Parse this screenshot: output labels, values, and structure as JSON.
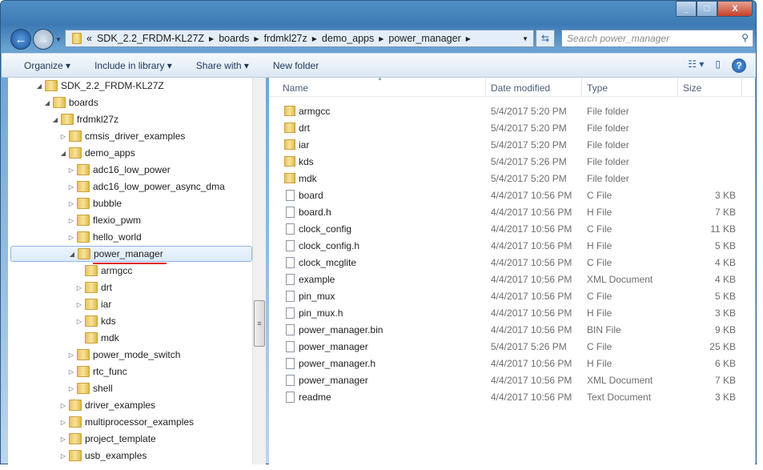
{
  "window": {
    "minimize": "_",
    "maximize": "□",
    "close": "X"
  },
  "address": {
    "prefix": "«",
    "segments": [
      "SDK_2.2_FRDM-KL27Z",
      "boards",
      "frdmkl27z",
      "demo_apps",
      "power_manager"
    ]
  },
  "search": {
    "placeholder": "Search power_manager"
  },
  "toolbar": {
    "organize": "Organize ▾",
    "include": "Include in library ▾",
    "share": "Share with ▾",
    "new_folder": "New folder",
    "views": "☷ ▾",
    "preview": "▯",
    "help": "?"
  },
  "tree": [
    {
      "label": "SDK_2.2_FRDM-KL27Z",
      "level": 0,
      "state": "expanded"
    },
    {
      "label": "boards",
      "level": 1,
      "state": "expanded"
    },
    {
      "label": "frdmkl27z",
      "level": 2,
      "state": "expanded"
    },
    {
      "label": "cmsis_driver_examples",
      "level": 3,
      "state": "collapsed"
    },
    {
      "label": "demo_apps",
      "level": 3,
      "state": "expanded"
    },
    {
      "label": "adc16_low_power",
      "level": 4,
      "state": "collapsed"
    },
    {
      "label": "adc16_low_power_async_dma",
      "level": 4,
      "state": "collapsed"
    },
    {
      "label": "bubble",
      "level": 4,
      "state": "collapsed"
    },
    {
      "label": "flexio_pwm",
      "level": 4,
      "state": "collapsed"
    },
    {
      "label": "hello_world",
      "level": 4,
      "state": "collapsed"
    },
    {
      "label": "power_manager",
      "level": 4,
      "state": "expanded",
      "selected": true
    },
    {
      "label": "armgcc",
      "level": 5,
      "state": "none"
    },
    {
      "label": "drt",
      "level": 5,
      "state": "collapsed"
    },
    {
      "label": "iar",
      "level": 5,
      "state": "collapsed"
    },
    {
      "label": "kds",
      "level": 5,
      "state": "collapsed"
    },
    {
      "label": "mdk",
      "level": 5,
      "state": "none"
    },
    {
      "label": "power_mode_switch",
      "level": 4,
      "state": "collapsed"
    },
    {
      "label": "rtc_func",
      "level": 4,
      "state": "collapsed"
    },
    {
      "label": "shell",
      "level": 4,
      "state": "collapsed"
    },
    {
      "label": "driver_examples",
      "level": 3,
      "state": "collapsed"
    },
    {
      "label": "multiprocessor_examples",
      "level": 3,
      "state": "collapsed"
    },
    {
      "label": "project_template",
      "level": 3,
      "state": "collapsed"
    },
    {
      "label": "usb_examples",
      "level": 3,
      "state": "collapsed"
    }
  ],
  "columns": {
    "name": "Name",
    "date": "Date modified",
    "type": "Type",
    "size": "Size"
  },
  "files": [
    {
      "name": "armgcc",
      "date": "5/4/2017 5:20 PM",
      "type": "File folder",
      "size": "",
      "kind": "folder"
    },
    {
      "name": "drt",
      "date": "5/4/2017 5:20 PM",
      "type": "File folder",
      "size": "",
      "kind": "folder"
    },
    {
      "name": "iar",
      "date": "5/4/2017 5:20 PM",
      "type": "File folder",
      "size": "",
      "kind": "folder"
    },
    {
      "name": "kds",
      "date": "5/4/2017 5:26 PM",
      "type": "File folder",
      "size": "",
      "kind": "folder"
    },
    {
      "name": "mdk",
      "date": "5/4/2017 5:20 PM",
      "type": "File folder",
      "size": "",
      "kind": "folder"
    },
    {
      "name": "board",
      "date": "4/4/2017 10:56 PM",
      "type": "C File",
      "size": "3 KB",
      "kind": "file"
    },
    {
      "name": "board.h",
      "date": "4/4/2017 10:56 PM",
      "type": "H File",
      "size": "7 KB",
      "kind": "file"
    },
    {
      "name": "clock_config",
      "date": "4/4/2017 10:56 PM",
      "type": "C File",
      "size": "11 KB",
      "kind": "file"
    },
    {
      "name": "clock_config.h",
      "date": "4/4/2017 10:56 PM",
      "type": "H File",
      "size": "5 KB",
      "kind": "file"
    },
    {
      "name": "clock_mcglite",
      "date": "4/4/2017 10:56 PM",
      "type": "C File",
      "size": "4 KB",
      "kind": "file"
    },
    {
      "name": "example",
      "date": "4/4/2017 10:56 PM",
      "type": "XML Document",
      "size": "4 KB",
      "kind": "file"
    },
    {
      "name": "pin_mux",
      "date": "4/4/2017 10:56 PM",
      "type": "C File",
      "size": "5 KB",
      "kind": "file"
    },
    {
      "name": "pin_mux.h",
      "date": "4/4/2017 10:56 PM",
      "type": "H File",
      "size": "3 KB",
      "kind": "file"
    },
    {
      "name": "power_manager.bin",
      "date": "4/4/2017 10:56 PM",
      "type": "BIN File",
      "size": "9 KB",
      "kind": "file"
    },
    {
      "name": "power_manager",
      "date": "5/4/2017 5:26 PM",
      "type": "C File",
      "size": "25 KB",
      "kind": "file"
    },
    {
      "name": "power_manager.h",
      "date": "4/4/2017 10:56 PM",
      "type": "H File",
      "size": "6 KB",
      "kind": "file"
    },
    {
      "name": "power_manager",
      "date": "4/4/2017 10:56 PM",
      "type": "XML Document",
      "size": "7 KB",
      "kind": "file"
    },
    {
      "name": "readme",
      "date": "4/4/2017 10:56 PM",
      "type": "Text Document",
      "size": "3 KB",
      "kind": "file"
    }
  ]
}
